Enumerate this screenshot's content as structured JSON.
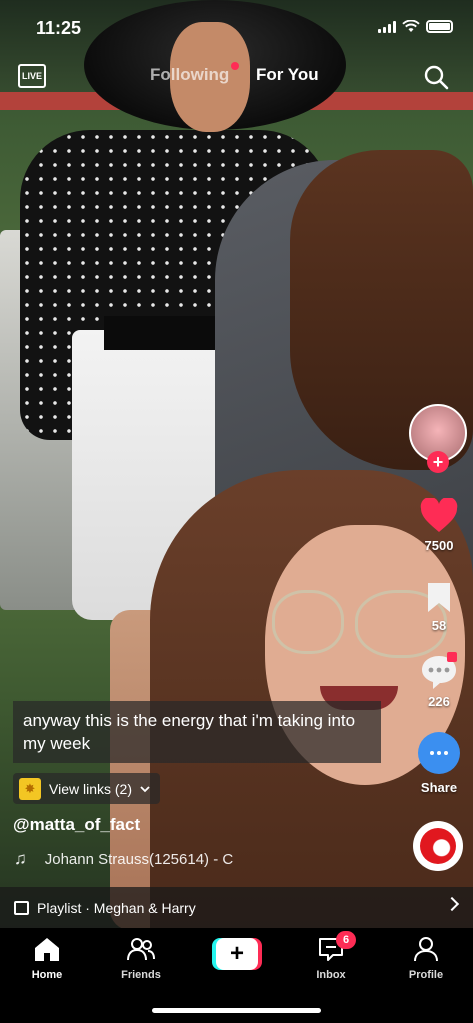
{
  "status_bar": {
    "time": "11:25"
  },
  "top_nav": {
    "live_label": "LIVE",
    "tabs": [
      {
        "label": "Following",
        "active": false,
        "has_dot": true
      },
      {
        "label": "For You",
        "active": true
      }
    ],
    "search_icon": "search-icon"
  },
  "right_rail": {
    "likes": "7500",
    "saves": "58",
    "comments": "226",
    "share_label": "Share"
  },
  "post": {
    "caption": "anyway this is the energy that i'm taking into my week",
    "links_label": "View links (2)",
    "username": "@matta_of_fact",
    "sound": "Johann Strauss(125614) - C"
  },
  "playlist": {
    "label": "Playlist · Meghan & Harry"
  },
  "bottom_nav": {
    "items": [
      {
        "label": "Home",
        "icon": "home-icon",
        "active": true
      },
      {
        "label": "Friends",
        "icon": "friends-icon",
        "active": false
      },
      {
        "label": "Inbox",
        "icon": "inbox-icon",
        "active": false,
        "badge": "6"
      },
      {
        "label": "Profile",
        "icon": "profile-icon",
        "active": false
      }
    ],
    "create_symbol": "+"
  },
  "colors": {
    "accent": "#fe2c55",
    "cyan": "#25f4ee",
    "share": "#3b8ff0"
  }
}
